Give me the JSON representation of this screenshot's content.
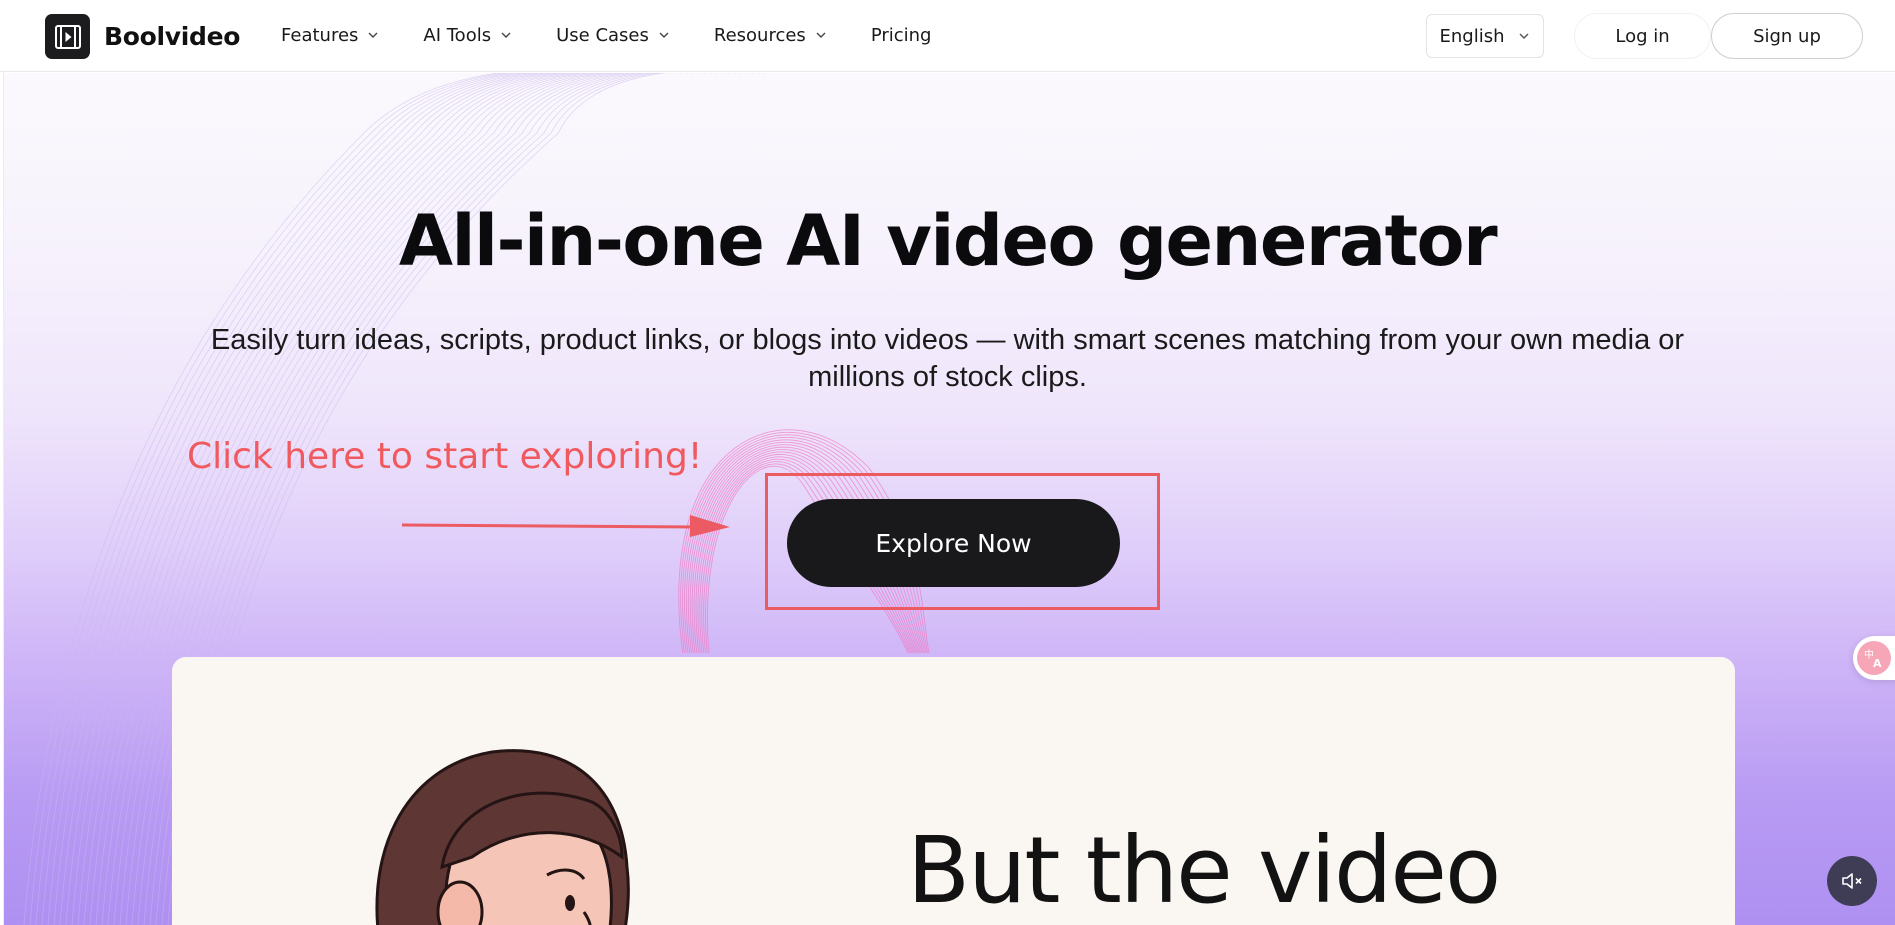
{
  "header": {
    "brand": "Boolvideo",
    "nav": [
      {
        "label": "Features",
        "has_dropdown": true
      },
      {
        "label": "AI Tools",
        "has_dropdown": true
      },
      {
        "label": "Use Cases",
        "has_dropdown": true
      },
      {
        "label": "Resources",
        "has_dropdown": true
      },
      {
        "label": "Pricing",
        "has_dropdown": false
      }
    ],
    "language": "English",
    "login_label": "Log in",
    "signup_label": "Sign up"
  },
  "hero": {
    "title": "All-in-one AI video generator",
    "subtitle": "Easily turn ideas, scripts, product links, or blogs into videos — with smart scenes matching from your own media or millions of stock clips.",
    "cta_label": "Explore Now"
  },
  "annotation": {
    "text": "Click here to start exploring!",
    "color": "#f05a5e"
  },
  "preview": {
    "caption": "But the video"
  },
  "widgets": {
    "translate_icon": "translate-icon",
    "mute_icon": "speaker-muted-icon"
  },
  "colors": {
    "cta_background": "#19181b",
    "hero_gradient_bottom": "#ae90f2",
    "annotation_red": "#ec5b63"
  }
}
